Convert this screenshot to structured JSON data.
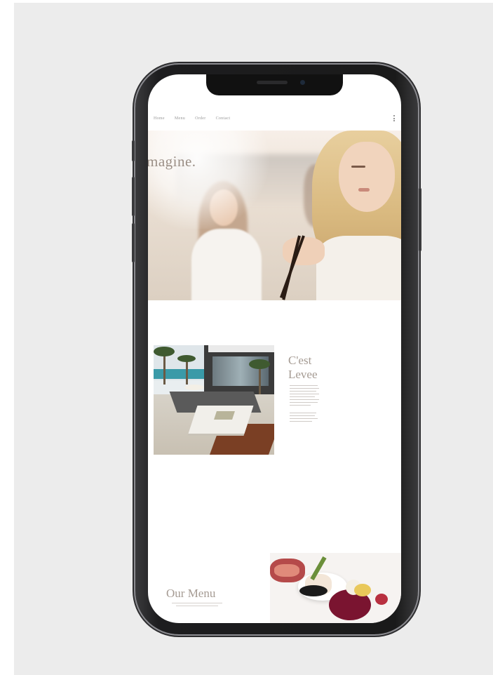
{
  "nav": {
    "items": [
      "Home",
      "Menu",
      "Order",
      "Contact"
    ]
  },
  "hero": {
    "title": "magine."
  },
  "about": {
    "title_line1": "C'est",
    "title_line2": "Levee"
  },
  "menu_section": {
    "title": "Our Menu"
  },
  "colors": {
    "background": "#ececec",
    "phone_frame": "#1d1d1f",
    "heading": "#a59b93",
    "nav_text": "#9a9a9a"
  },
  "icons": {
    "menu": "more-vertical-icon"
  }
}
